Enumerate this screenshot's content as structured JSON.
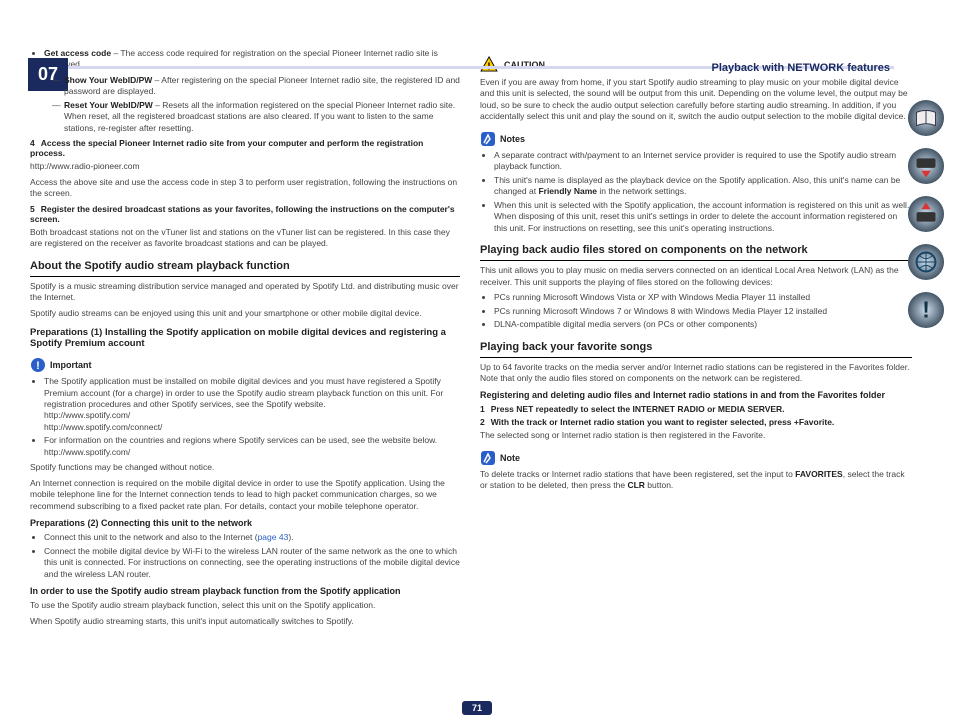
{
  "chapter": "07",
  "header_title_pre": "Playback with ",
  "header_title_net": "NETWORK",
  "header_title_post": " features",
  "left": {
    "b1a": "Get access code",
    "b1b": " – The access code required for registration on the special Pioneer Internet radio site is displayed.",
    "b2a": "Show Your WebID/PW",
    "b2b": " – After registering on the special Pioneer Internet radio site, the registered ID and password are displayed.",
    "b3a": "Reset Your WebID/PW",
    "b3b": " – Resets all the information registered on the special Pioneer Internet radio site. When reset, all the registered broadcast stations are also cleared. If you want to listen to the same stations, re-register after resetting.",
    "s4n": "4",
    "s4t": "Access the special Pioneer Internet radio site from your computer and perform the registration process.",
    "s4url": "http://www.radio-pioneer.com",
    "s4p": "Access the above site and use the access code in step 3 to perform user registration, following the instructions on the screen.",
    "s5n": "5",
    "s5t": "Register the desired broadcast stations as your favorites, following the instructions on the computer's screen.",
    "s5p": "Both broadcast stations not on the vTuner list and stations on the vTuner list can be registered. In this case they are registered on the receiver as favorite broadcast stations and can be played.",
    "h_spotify": "About the Spotify audio stream playback function",
    "p_sp1": "Spotify is a music streaming distribution service managed and operated by Spotify Ltd. and distributing music over the Internet.",
    "p_sp2": "Spotify audio streams can be enjoyed using this unit and your smartphone or other mobile digital device.",
    "h_prep1": "Preparations (1) Installing the Spotify application on mobile digital devices and registering a Spotify Premium account",
    "important": "Important",
    "imp_b1": "The Spotify application must be installed on mobile digital devices and you must have registered a Spotify Premium account (for a charge) in order to use the Spotify audio stream playback function on this unit. For registration procedures and other Spotify services, see the Spotify website.",
    "imp_u1": "http://www.spotify.com/",
    "imp_u2": "http://www.spotify.com/connect/",
    "imp_b2": "For information on the countries and regions where Spotify services can be used, see the website below.",
    "imp_u3": "http://www.spotify.com/",
    "p_sp3": "Spotify functions may be changed without notice.",
    "p_sp4": "An Internet connection is required on the mobile digital device in order to use the Spotify application. Using the mobile telephone line for the Internet connection tends to lead to high packet communication charges, so we recommend subscribing to a fixed packet rate plan. For details, contact your mobile telephone operator.",
    "h_prep2": "Preparations (2) Connecting this unit to the network",
    "p2_b1a": "Connect this unit to the network and also to the Internet (",
    "p2_b1link": "page 43",
    "p2_b1c": ").",
    "p2_b2": "Connect the mobile digital device by Wi-Fi to the wireless LAN router of the same network as the one to which this unit is connected. For instructions on connecting, see the operating instructions of the mobile digital device and the wireless LAN router.",
    "h_inorder": "In order to use the Spotify audio stream playback function from the Spotify application",
    "p_ord1": "To use the Spotify audio stream playback function, select this unit on the Spotify application.",
    "p_ord2": "When Spotify audio streaming starts, this unit's input automatically switches to Spotify."
  },
  "right": {
    "caution": "CAUTION",
    "caution_p": "Even if you are away from home, if you start Spotify audio streaming to play music on your mobile digital device and this unit is selected, the sound will be output from this unit. Depending on the volume level, the output may be loud, so be sure to check the audio output selection carefully before starting audio streaming. In addition, if you accidentally select this unit and play the sound on it, switch the audio output selection to the mobile digital device.",
    "notes": "Notes",
    "n1": "A separate contract with/payment to an Internet service provider is required to use the Spotify audio stream playback function.",
    "n2a": "This unit's name is displayed as the playback device on the Spotify application. Also, this unit's name can be changed at ",
    "n2b": "Friendly Name",
    "n2c": " in the network settings.",
    "n3": "When this unit is selected with the Spotify application, the account information is registered on this unit as well. When disposing of this unit, reset this unit's settings in order to delete the account information registered on this unit. For instructions on resetting, see this unit's operating instructions.",
    "h_net": "Playing back audio files stored on components on the network",
    "p_net": "This unit allows you to play music on media servers connected on an identical Local Area Network (LAN) as the receiver. This unit supports the playing of files stored on the following devices:",
    "net_b1": "PCs running Microsoft Windows Vista or XP with Windows Media Player 11 installed",
    "net_b2": "PCs running Microsoft Windows 7 or Windows 8 with Windows Media Player 12 installed",
    "net_b3": "DLNA-compatible digital media servers (on PCs or other components)",
    "h_fav": "Playing back your favorite songs",
    "p_fav": "Up to 64 favorite tracks on the media server and/or Internet radio stations can be registered in the Favorites folder. Note that only the audio files stored on components on the network can be registered.",
    "h_reg": "Registering and deleting audio files and Internet radio stations in and from the Favorites folder",
    "s1n": "1",
    "s1t": "Press NET repeatedly to select the INTERNET RADIO or MEDIA SERVER.",
    "s2n": "2",
    "s2t": "With the track or Internet radio station you want to register selected, press +Favorite.",
    "p_sel": "The selected song or Internet radio station is then registered in the Favorite.",
    "note": "Note",
    "p_note_a": "To delete tracks or Internet radio stations that have been registered, set the input to ",
    "p_note_b": "FAVORITES",
    "p_note_c": ", select the track or station to be deleted, then press the ",
    "p_note_d": "CLR",
    "p_note_e": " button."
  },
  "page_number": "71"
}
